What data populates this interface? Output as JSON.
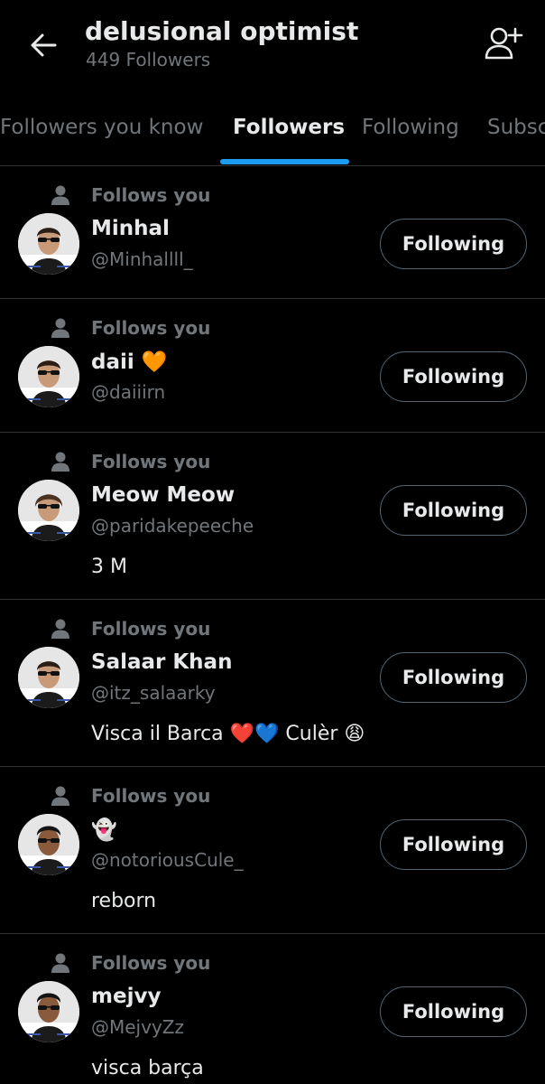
{
  "header": {
    "title": "delusional optimist",
    "followers_count": "449 Followers"
  },
  "tabs": [
    "Followers you know",
    "Followers",
    "Following",
    "Subscriptions"
  ],
  "active_tab": "Followers",
  "accent_color": "#1d9bf0",
  "icons": {
    "back": "arrow-left-icon",
    "add_user": "add-user-icon",
    "follows_you": "person-icon"
  },
  "followers": [
    {
      "follows_label": "Follows you",
      "name": "Minhal",
      "handle": "@Minhallll_",
      "bio": "",
      "button": "Following"
    },
    {
      "follows_label": "Follows you",
      "name": "daii 🧡",
      "handle": "@daiiirn",
      "bio": "",
      "button": "Following"
    },
    {
      "follows_label": "Follows you",
      "name": "Meow Meow",
      "handle": "@paridakepeeche",
      "bio": "3 M",
      "button": "Following"
    },
    {
      "follows_label": "Follows you",
      "name": "Salaar Khan",
      "handle": "@itz_salaarky",
      "bio": "Visca il Barca ❤️💙 Culèr 😩",
      "button": "Following"
    },
    {
      "follows_label": "Follows you",
      "name": "👻",
      "handle": "@notoriousCule_",
      "bio": "reborn",
      "button": "Following"
    },
    {
      "follows_label": "Follows you",
      "name": "mejvy",
      "handle": "@MejvyZz",
      "bio": "visca barça",
      "button": "Following"
    }
  ]
}
